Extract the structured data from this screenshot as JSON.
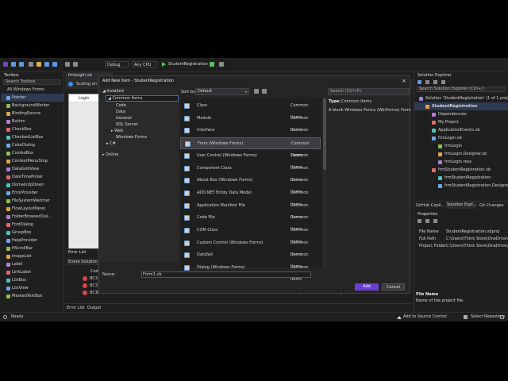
{
  "toolbar": {
    "config": "Debug",
    "platform": "Any CPU",
    "run": "StudentRegistration"
  },
  "toolbox": {
    "title": "Toolbox",
    "search": "Search Toolbox",
    "group": "All Windows Forms",
    "items": [
      "Pointer",
      "BackgroundWorker",
      "BindingSource",
      "Button",
      "CheckBox",
      "CheckedListBox",
      "ColorDialog",
      "ComboBox",
      "ContextMenuStrip",
      "DataGridView",
      "DateTimePicker",
      "DomainUpDown",
      "ErrorProvider",
      "FileSystemWatcher",
      "FlowLayoutPanel",
      "FolderBrowserDial...",
      "FontDialog",
      "GroupBox",
      "HelpProvider",
      "HScrollBar",
      "ImageList",
      "Label",
      "LinkLabel",
      "ListBox",
      "ListView",
      "MaskedTextBox"
    ]
  },
  "editor": {
    "tab": "frmLogin.vb",
    "info": "Scaling on yo",
    "form_title": "Login"
  },
  "errorlist": {
    "title": "Error List",
    "scope": "Entire Solution",
    "col": "Cod",
    "rows": [
      {
        "code": "BC3",
        "text": ""
      },
      {
        "code": "BC3",
        "text": ""
      },
      {
        "code": "BC3",
        "text": "0: Type 'PrintGroup' is not defined.",
        "project": "StudentRegistration",
        "file": "frmLogin.vb",
        "line": "46"
      }
    ],
    "tabs": [
      "Error List",
      "Output"
    ]
  },
  "solution": {
    "title": "Solution Explorer",
    "search": "Search Solution Explorer (Ctrl+;)",
    "rows": [
      {
        "label": "Solution 'StudentRegistration' (1 of 1 proje",
        "indent": 0
      },
      {
        "label": "StudentRegistration",
        "indent": 1
      },
      {
        "label": "Dependencies",
        "indent": 2
      },
      {
        "label": "My Project",
        "indent": 2
      },
      {
        "label": "ApplicationEvents.vb",
        "indent": 2
      },
      {
        "label": "frmLogin.vb",
        "indent": 2
      },
      {
        "label": "frmLogin",
        "indent": 3
      },
      {
        "label": "frmLogin.Designer.vb",
        "indent": 3
      },
      {
        "label": "frmLogin.resx",
        "indent": 3
      },
      {
        "label": "frmStudentRegistration.vb",
        "indent": 2
      },
      {
        "label": "frmStudentRegistration",
        "indent": 3
      },
      {
        "label": "frmStudentRegistration.Designer.vb",
        "indent": 3
      }
    ],
    "tabs": [
      "GitHub Copil...",
      "Solution Expl...",
      "Git Changes"
    ]
  },
  "properties": {
    "title": "Properties",
    "rows": [
      {
        "k": "File Name",
        "v": "StudentRegistration.vbproj"
      },
      {
        "k": "Full Path",
        "v": "C:\\Users\\Think Store\\OneDrive\\De"
      },
      {
        "k": "Project Folder",
        "v": "C:\\Users\\Think Store\\OneDrive\\De"
      }
    ],
    "desc_title": "File Name",
    "desc_text": "Name of the project file."
  },
  "status": {
    "left": "Ready",
    "source": "Add to Source Control",
    "repo": "Select Repository"
  },
  "dialog": {
    "title": "Add New Item - StudentRegistration",
    "installed": "Installed",
    "tree": [
      "Common Items",
      "Code",
      "Data",
      "General",
      "SQL Server",
      "Web",
      "Windows Forms",
      "C#",
      "Online"
    ],
    "sort_label": "Sort by:",
    "sort_value": "Default",
    "search": "Search (Ctrl+E)",
    "templates": [
      {
        "name": "Class",
        "cat": "Common Items"
      },
      {
        "name": "Module",
        "cat": "Common Items"
      },
      {
        "name": "Interface",
        "cat": "Common Items"
      },
      {
        "name": "Form (Windows Forms)",
        "cat": "Common Items"
      },
      {
        "name": "User Control (Windows Forms)",
        "cat": "Common Items"
      },
      {
        "name": "Component Class",
        "cat": "Common Items"
      },
      {
        "name": "About Box (Windows Forms)",
        "cat": "Common Items"
      },
      {
        "name": "ADO.NET Entity Data Model",
        "cat": "Common Items"
      },
      {
        "name": "Application Manifest File",
        "cat": "Common Items"
      },
      {
        "name": "Code File",
        "cat": "Common Items"
      },
      {
        "name": "COM Class",
        "cat": "Common Items"
      },
      {
        "name": "Custom Control (Windows Forms)",
        "cat": "Common Items"
      },
      {
        "name": "DataSet",
        "cat": "Common Items"
      },
      {
        "name": "Dialog (Windows Forms)",
        "cat": "Common Items"
      }
    ],
    "type_label": "Type:",
    "type_value": "Common Items",
    "desc": "A blank Windows Forms (WinForms) Form",
    "name_label": "Name:",
    "name_value": "Form1.vb",
    "add": "Add",
    "cancel": "Cancel"
  }
}
